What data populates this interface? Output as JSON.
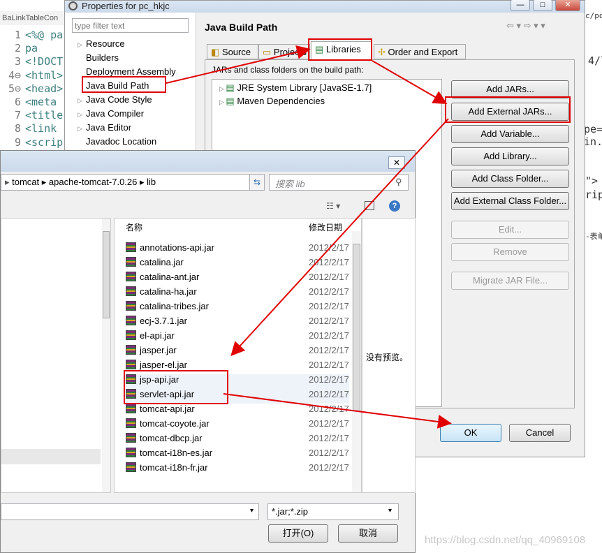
{
  "editor": {
    "tab_label": "BaLinkTableCon",
    "lines": [
      {
        "num": "1",
        "code": "<%@ pa"
      },
      {
        "num": "2",
        "code": "    pa"
      },
      {
        "num": "3",
        "code": "<!DOCT"
      },
      {
        "num": "4⊖",
        "code": "<html>"
      },
      {
        "num": "5⊖",
        "code": "<head>"
      },
      {
        "num": "6",
        "code": "<meta"
      },
      {
        "num": "7",
        "code": "<title"
      },
      {
        "num": "8",
        "code": "<link"
      },
      {
        "num": "9",
        "code": "<scrip"
      }
    ],
    "right_fragments": [
      "c/pon",
      "4/l",
      "pe=",
      "in.",
      "\">",
      "rip",
      "-表单"
    ]
  },
  "properties": {
    "title": "Properties for pc_hkjc",
    "window_buttons": [
      "—",
      "□",
      "✕"
    ],
    "filter_placeholder": "type filter text",
    "nav": [
      {
        "label": "Resource",
        "arrow": "▷"
      },
      {
        "label": "Builders",
        "arrow": ""
      },
      {
        "label": "Deployment Assembly",
        "arrow": ""
      },
      {
        "label": "Java Build Path",
        "arrow": ""
      },
      {
        "label": "Java Code Style",
        "arrow": "▷"
      },
      {
        "label": "Java Compiler",
        "arrow": "▷"
      },
      {
        "label": "Java Editor",
        "arrow": "▷"
      },
      {
        "label": "Javadoc Location",
        "arrow": ""
      }
    ],
    "page_title": "Java Build Path",
    "tabs": [
      "Source",
      "Projects",
      "Libraries",
      "Order and Export"
    ],
    "jars_label": "JARs and class folders on the build path:",
    "tree": [
      "JRE System Library [JavaSE-1.7]",
      "Maven Dependencies"
    ],
    "buttons": [
      "Add JARs...",
      "Add External JARs...",
      "Add Variable...",
      "Add Library...",
      "Add Class Folder...",
      "Add External Class Folder...",
      "Edit...",
      "Remove",
      "Migrate JAR File..."
    ],
    "ok": "OK",
    "cancel": "Cancel"
  },
  "file_dialog": {
    "breadcrumb": "tomcat  ▸  apache-tomcat-7.0.26  ▸  lib",
    "search_placeholder": "搜索 lib",
    "col_name": "名称",
    "col_date": "修改日期",
    "no_preview": "没有预览。",
    "files": [
      {
        "name": "annotations-api.jar",
        "date": "2012/2/17"
      },
      {
        "name": "catalina.jar",
        "date": "2012/2/17"
      },
      {
        "name": "catalina-ant.jar",
        "date": "2012/2/17"
      },
      {
        "name": "catalina-ha.jar",
        "date": "2012/2/17"
      },
      {
        "name": "catalina-tribes.jar",
        "date": "2012/2/17"
      },
      {
        "name": "ecj-3.7.1.jar",
        "date": "2012/2/17"
      },
      {
        "name": "el-api.jar",
        "date": "2012/2/17"
      },
      {
        "name": "jasper.jar",
        "date": "2012/2/17"
      },
      {
        "name": "jasper-el.jar",
        "date": "2012/2/17"
      },
      {
        "name": "jsp-api.jar",
        "date": "2012/2/17"
      },
      {
        "name": "servlet-api.jar",
        "date": "2012/2/17"
      },
      {
        "name": "tomcat-api.jar",
        "date": "2012/2/17"
      },
      {
        "name": "tomcat-coyote.jar",
        "date": "2012/2/17"
      },
      {
        "name": "tomcat-dbcp.jar",
        "date": "2012/2/17"
      },
      {
        "name": "tomcat-i18n-es.jar",
        "date": "2012/2/17"
      },
      {
        "name": "tomcat-i18n-fr.jar",
        "date": "2012/2/17"
      }
    ],
    "file_type": "*.jar;*.zip",
    "open": "打开(O)",
    "cancel": "取消"
  },
  "watermark": "https://blog.csdn.net/qq_40969108"
}
